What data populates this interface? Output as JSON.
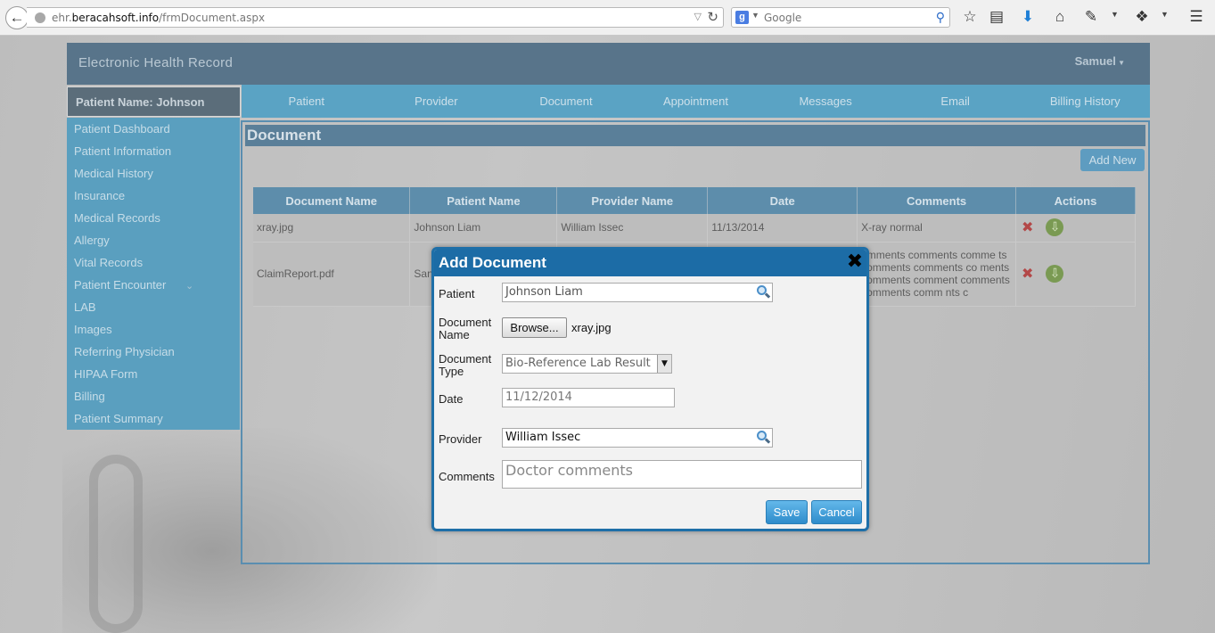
{
  "browser": {
    "url_prefix": "ehr.",
    "url_host": "beracahsoft.info",
    "url_path": "/frmDocument.aspx",
    "search_placeholder": "Google",
    "search_engine_letter": "g"
  },
  "app": {
    "title": "Electronic Health Record",
    "user": "Samuel",
    "patient_name_label": "Patient Name: Johnson"
  },
  "nav": {
    "tabs": [
      "Patient",
      "Provider",
      "Document",
      "Appointment",
      "Messages",
      "Email",
      "Billing History"
    ]
  },
  "sidebar": {
    "items": [
      "Patient Dashboard",
      "Patient Information",
      "Medical History",
      "Insurance",
      "Medical Records",
      "Allergy",
      "Vital Records",
      "Patient Encounter",
      "LAB",
      "Images",
      "Referring Physician",
      "HIPAA Form",
      "Billing",
      "Patient Summary"
    ]
  },
  "document_page": {
    "title": "Document",
    "add_new_label": "Add New",
    "table": {
      "headers": [
        "Document Name",
        "Patient Name",
        "Provider Name",
        "Date",
        "Comments",
        "Actions"
      ],
      "rows": [
        {
          "document_name": "xray.jpg",
          "patient_name": "Johnson Liam",
          "provider_name": "William Issec",
          "date": "11/13/2014",
          "comments": "X-ray normal"
        },
        {
          "document_name": "ClaimReport.pdf",
          "patient_name": "San",
          "provider_name": "",
          "date": "",
          "comments": "omments comments comme ts comments comments co ments comments comment comments comments comm nts c"
        }
      ]
    }
  },
  "modal": {
    "title": "Add Document",
    "close_glyph": "✖",
    "labels": {
      "patient": "Patient",
      "document_name": "Document Name",
      "document_type": "Document Type",
      "date": "Date",
      "provider": "Provider",
      "comments": "Comments"
    },
    "patient_value": "Johnson Liam",
    "browse_label": "Browse...",
    "file_name": "xray.jpg",
    "document_type_value": "Bio-Reference Lab Result",
    "date_value": "11/12/2014",
    "provider_value": "William Issec",
    "comments_placeholder": "Doctor comments",
    "save_label": "Save",
    "cancel_label": "Cancel"
  },
  "colors": {
    "modal_header": "#1c6ca6",
    "nav_bar": "#5aa3c4",
    "sidebar": "#5a9fbf",
    "app_header": "#58748a",
    "button_blue": "#2e8ccb"
  }
}
